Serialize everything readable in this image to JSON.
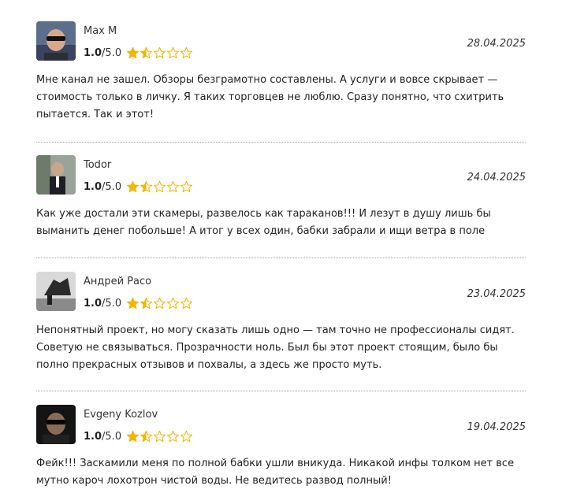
{
  "reviews": [
    {
      "author": "Max M",
      "score": "1.0",
      "max": "/5.0",
      "date": "28.04.2025",
      "text": "Мне канал не зашел. Обзоры безграмотно составлены. А услуги и вовсе скрывает — стоимость только в личку. Я таких торговцев не люблю. Сразу понятно, что схитрить пытается. Так и этот!",
      "rating_value": 1.5
    },
    {
      "author": "Todor",
      "score": "1.0",
      "max": "/5.0",
      "date": "24.04.2025",
      "text": "Как уже достали эти скамеры, развелось как тараканов!!! И лезут в душу лишь бы выманить денег побольше! А итог у всех один, бабки забрали и ищи ветра в поле",
      "rating_value": 1.5
    },
    {
      "author": "Андрей Расо",
      "score": "1.0",
      "max": "/5.0",
      "date": "23.04.2025",
      "text": "Непонятный проект, но могу сказать лишь одно — там точно не профессионалы сидят. Советую не связываться. Прозрачности ноль. Был бы этот проект стоящим, было бы полно прекрасных отзывов и похвалы, а здесь же просто муть.",
      "rating_value": 1.5
    },
    {
      "author": "Evgeny Kozlov",
      "score": "1.0",
      "max": "/5.0",
      "date": "19.04.2025",
      "text": "Фейк!!! Засками​ли меня по полной бабки ушли вникуда. Никакой инфы толком нет все мутно кароч лохотрон чистой воды. Не ведитесь развод полный!",
      "rating_value": 1.5
    }
  ],
  "colors": {
    "star": "#f2b500",
    "divider": "#999999"
  },
  "icons": {
    "star": "star-icon",
    "avatar": "avatar"
  }
}
